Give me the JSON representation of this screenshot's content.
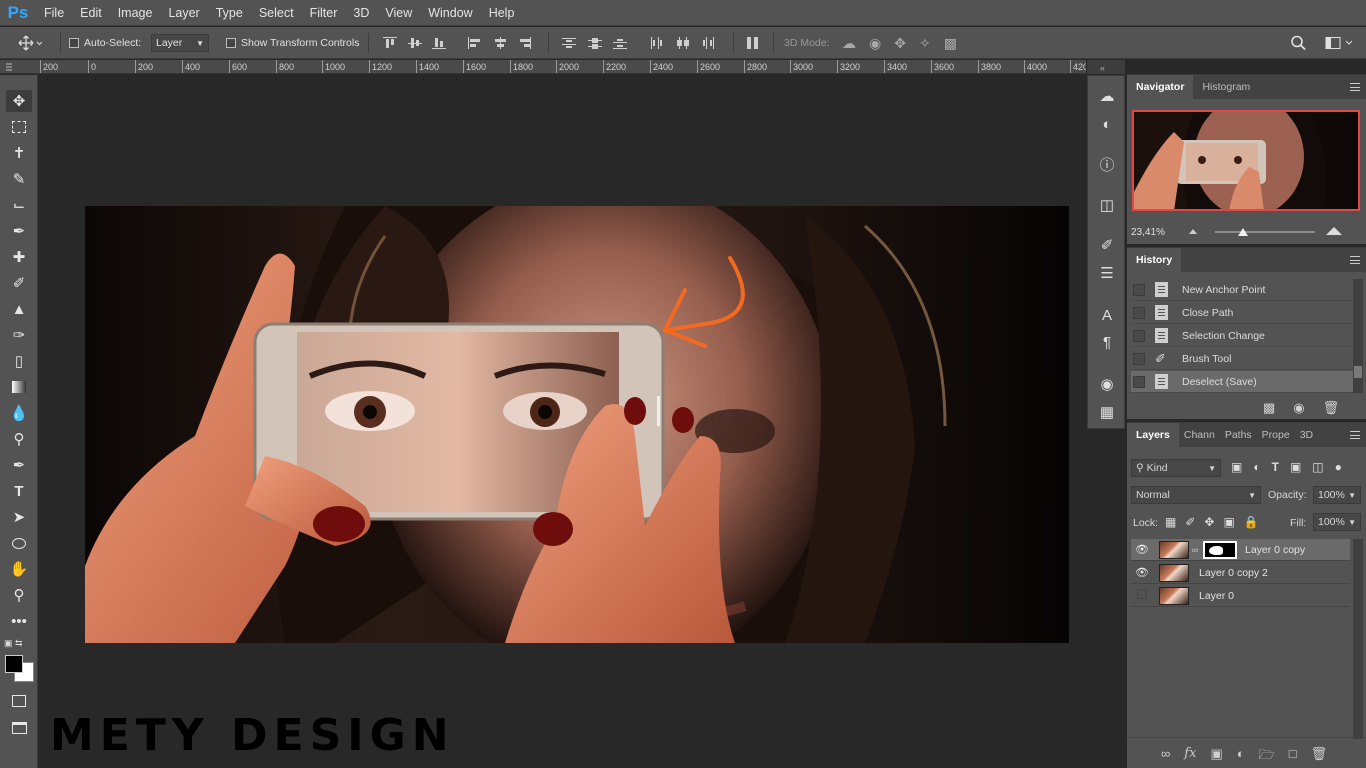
{
  "app": {
    "logo": "Ps"
  },
  "menu": [
    "File",
    "Edit",
    "Image",
    "Layer",
    "Type",
    "Select",
    "Filter",
    "3D",
    "View",
    "Window",
    "Help"
  ],
  "options_bar": {
    "auto_select_label": "Auto-Select:",
    "auto_select_value": "Layer",
    "show_transform_label": "Show Transform Controls",
    "mode_3d_label": "3D Mode:"
  },
  "ruler": {
    "ticks": [
      "200",
      "0",
      "200",
      "400",
      "600",
      "800",
      "1000",
      "1200",
      "1400",
      "1600",
      "1800",
      "2000",
      "2200",
      "2400",
      "2600",
      "2800",
      "3000",
      "3200",
      "3400",
      "3600",
      "3800",
      "4000",
      "420"
    ]
  },
  "navigator": {
    "tabs": [
      "Navigator",
      "Histogram"
    ],
    "zoom": "23,41%",
    "zoom_fraction": 0.28
  },
  "history": {
    "title": "History",
    "items": [
      "New Anchor Point",
      "Close Path",
      "Selection Change",
      "Brush Tool",
      "Deselect (Save)"
    ]
  },
  "layers_panel": {
    "tabs": [
      "Layers",
      "Chann",
      "Paths",
      "Prope",
      "3D"
    ],
    "filter_kind": "Kind",
    "blend_mode": "Normal",
    "opacity_label": "Opacity:",
    "opacity_value": "100%",
    "lock_label": "Lock:",
    "fill_label": "Fill:",
    "fill_value": "100%",
    "layers": [
      {
        "name": "Layer 0 copy",
        "visible": true,
        "has_mask": true,
        "selected": true
      },
      {
        "name": "Layer 0 copy 2",
        "visible": true,
        "has_mask": false,
        "selected": false
      },
      {
        "name": "Layer 0",
        "visible": false,
        "has_mask": false,
        "selected": false
      }
    ]
  },
  "watermark": "METY DESIGN",
  "colors": {
    "accent": "#31a8ff",
    "navigator_box": "#e04848",
    "arrow": "#f26a21"
  }
}
